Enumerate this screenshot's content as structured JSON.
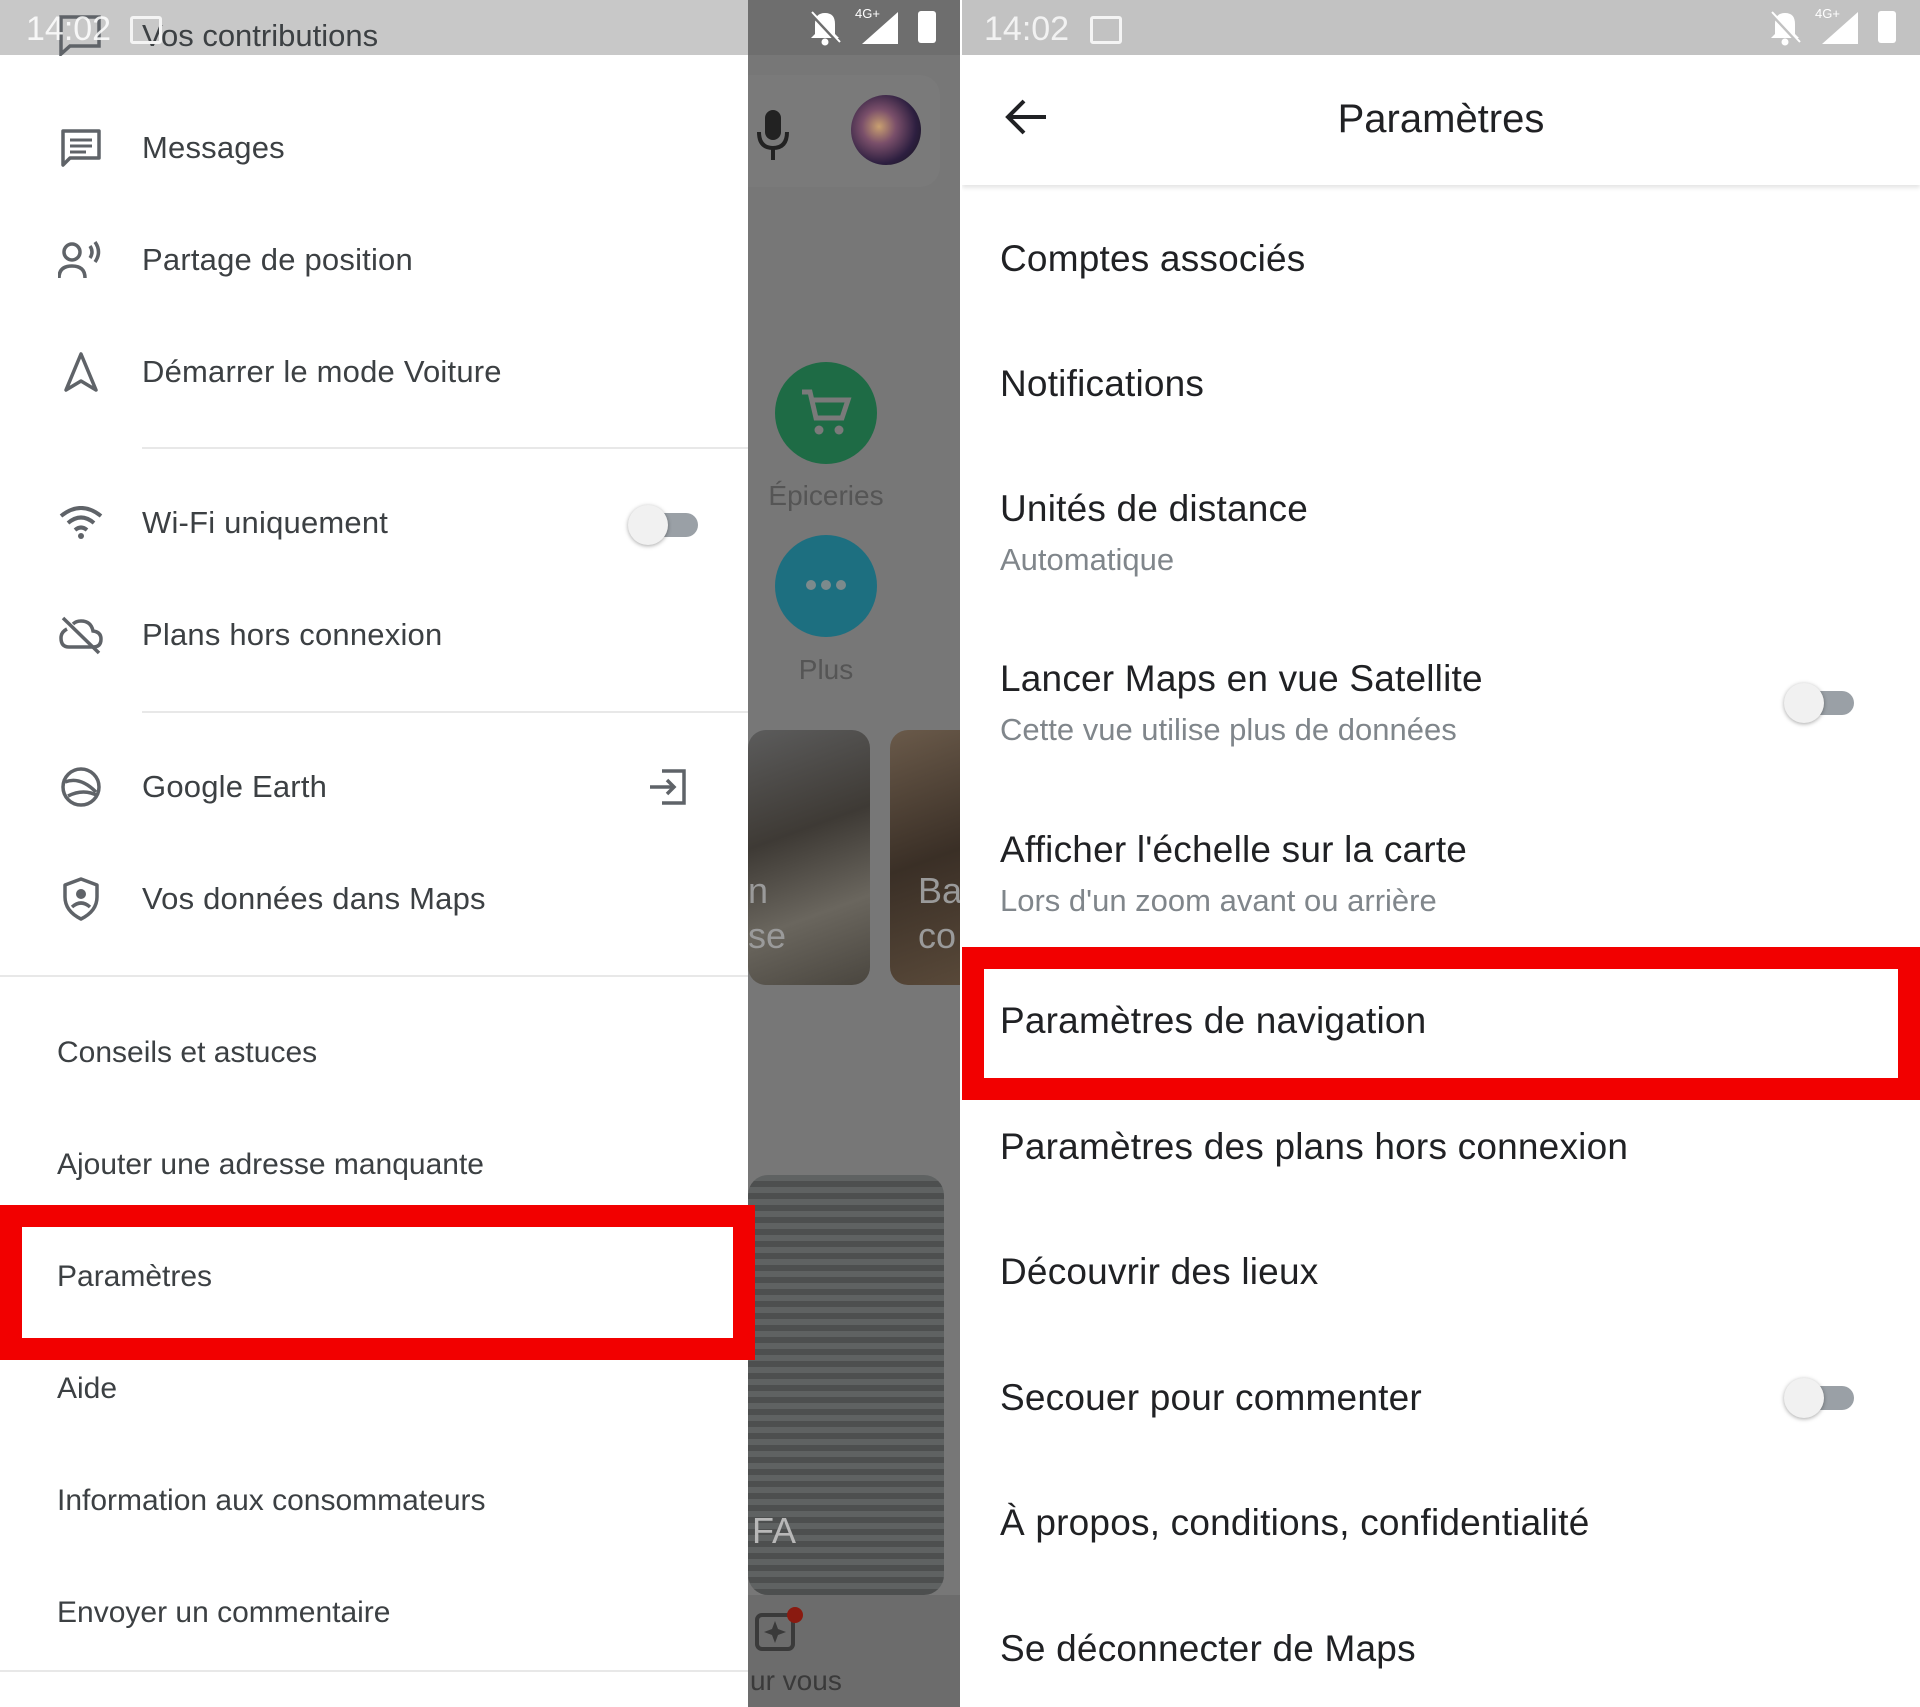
{
  "status_bar": {
    "time": "14:02",
    "network": "4G+"
  },
  "left_screen": {
    "drawer": {
      "top_partial_item": "Vos contributions",
      "items": [
        {
          "label": "Messages",
          "icon": "message-icon"
        },
        {
          "label": "Partage de position",
          "icon": "location-sharing-icon"
        },
        {
          "label": "Démarrer le mode Voiture",
          "icon": "navigation-arrow-icon"
        },
        {
          "label": "Wi-Fi uniquement",
          "icon": "wifi-icon",
          "toggle": false
        },
        {
          "label": "Plans hors connexion",
          "icon": "cloud-off-icon"
        },
        {
          "label": "Google Earth",
          "icon": "google-earth-icon",
          "trailing_icon": "open-external-icon"
        },
        {
          "label": "Vos données dans Maps",
          "icon": "shield-icon"
        }
      ],
      "secondary_items": [
        "Conseils et astuces",
        "Ajouter une adresse manquante",
        "Paramètres",
        "Aide",
        "Information aux consommateurs",
        "Envoyer un commentaire"
      ],
      "highlighted_item": "Paramètres"
    },
    "background_app": {
      "categories": [
        {
          "label": "Épiceries",
          "color": "#1e6b45",
          "icon": "cart-icon"
        },
        {
          "label": "Plus",
          "color": "#1d6f80",
          "icon": "more-dots-icon"
        }
      ],
      "card_texts": [
        "n",
        "se",
        "Ba",
        "co"
      ],
      "stadium_text": "FA",
      "bottom_nav_label": "ur vous"
    }
  },
  "right_screen": {
    "title": "Paramètres",
    "items": [
      {
        "title": "Comptes associés"
      },
      {
        "title": "Notifications"
      },
      {
        "title": "Unités de distance",
        "subtitle": "Automatique"
      },
      {
        "title": "Lancer Maps en vue Satellite",
        "subtitle": "Cette vue utilise plus de données",
        "toggle": false
      },
      {
        "title": "Afficher l'échelle sur la carte",
        "subtitle": "Lors d'un zoom avant ou arrière"
      },
      {
        "title": "Paramètres de navigation"
      },
      {
        "title": "Paramètres des plans hors connexion"
      },
      {
        "title": "Découvrir des lieux"
      },
      {
        "title": "Secouer pour commenter",
        "toggle": false
      },
      {
        "title": "À propos, conditions, confidentialité"
      },
      {
        "title": "Se déconnecter de Maps"
      }
    ],
    "highlighted_item": "Paramètres de navigation"
  },
  "colors": {
    "highlight": "#f20000",
    "text_primary": "#202124",
    "text_secondary": "#80868b"
  }
}
